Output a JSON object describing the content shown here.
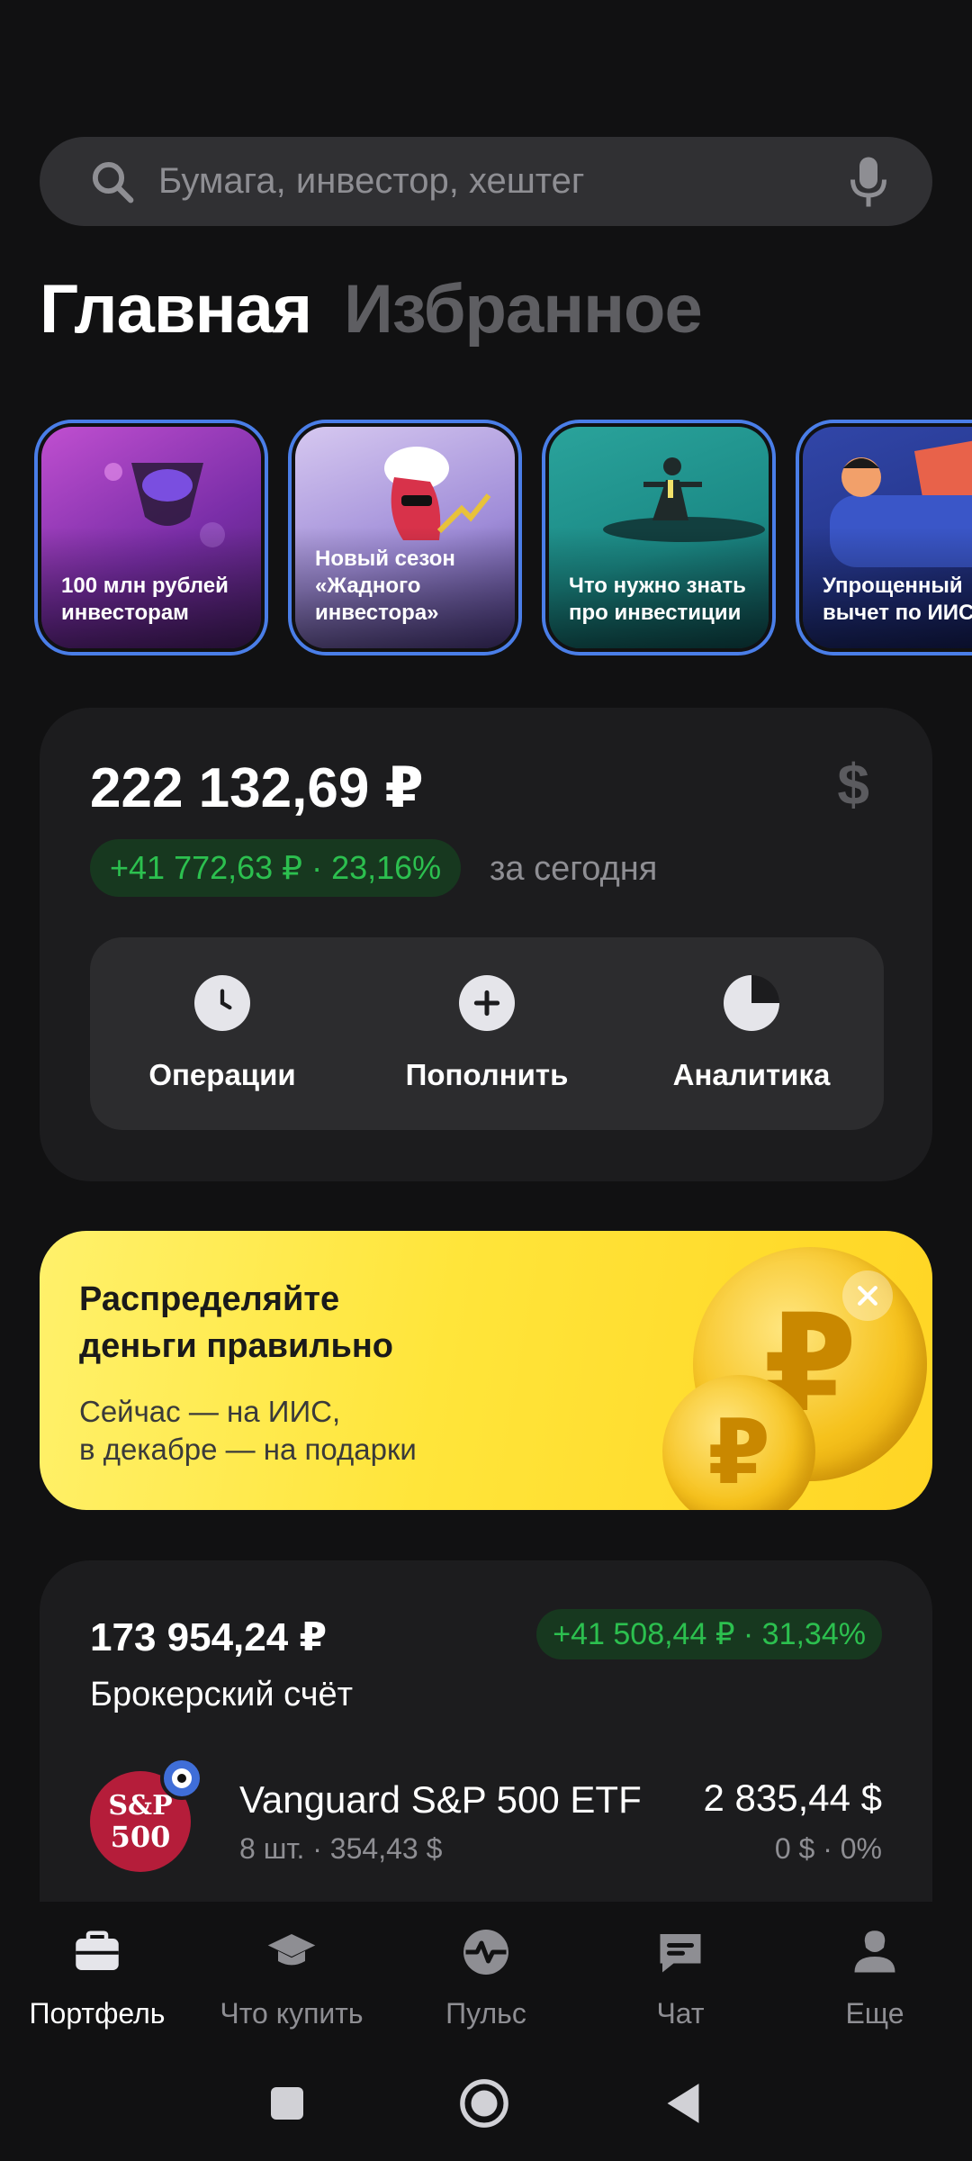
{
  "search": {
    "placeholder": "Бумага, инвестор, хештег"
  },
  "tabs": [
    {
      "label": "Главная",
      "active": true
    },
    {
      "label": "Избранное",
      "active": false
    }
  ],
  "stories": [
    {
      "label": "100 млн рублей инвесторам"
    },
    {
      "label": "Новый сезон «Жадного инвестора»"
    },
    {
      "label": "Что нужно знать про инвестиции"
    },
    {
      "label": "Упрощенный вычет по ИИС"
    }
  ],
  "portfolio": {
    "total": "222 132,69 ₽",
    "currency_toggle": "$",
    "gain": "+41 772,63 ₽ · 23,16%",
    "gain_caption": "за сегодня",
    "actions": [
      {
        "label": "Операции",
        "icon": "clock-icon"
      },
      {
        "label": "Пополнить",
        "icon": "plus-icon"
      },
      {
        "label": "Аналитика",
        "icon": "pie-chart-icon"
      }
    ]
  },
  "promo": {
    "title": "Распределяйте\nденьги правильно",
    "subtitle": "Сейчас — на ИИС,\nв декабре — на подарки",
    "coin_symbol": "₽"
  },
  "broker": {
    "total": "173 954,24 ₽",
    "gain": "+41 508,44 ₽ · 31,34%",
    "name": "Брокерский счёт",
    "position": {
      "logo_line1": "S&P",
      "logo_line2": "500",
      "name": "Vanguard S&P 500 ETF",
      "qty": "8 шт. · 354,43 $",
      "value": "2 835,44 $",
      "change": "0 $ · 0%"
    }
  },
  "nav": [
    {
      "label": "Портфель",
      "icon": "briefcase-icon",
      "active": true
    },
    {
      "label": "Что купить",
      "icon": "graduation-cap-icon",
      "active": false
    },
    {
      "label": "Пульс",
      "icon": "pulse-icon",
      "active": false
    },
    {
      "label": "Чат",
      "icon": "chat-icon",
      "active": false
    },
    {
      "label": "Еще",
      "icon": "profile-icon",
      "active": false
    }
  ],
  "colors": {
    "background": "#111112",
    "card": "#1c1c1e",
    "gain_green": "#2cc04f",
    "promo_yellow": "#ffe53a",
    "story_border": "#4a7ee8"
  }
}
